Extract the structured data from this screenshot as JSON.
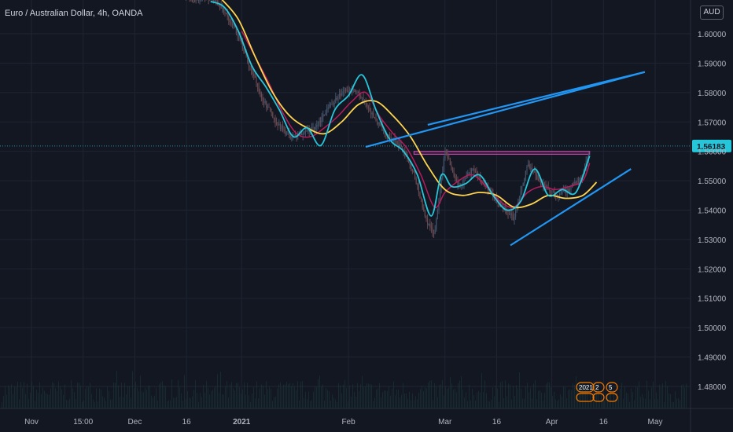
{
  "header": {
    "title": "Euro / Australian Dollar, 4h, OANDA",
    "currency": "AUD"
  },
  "colors": {
    "background": "#131722",
    "grid": "#1f2433",
    "candle_up": "#42546b",
    "candle_down": "#6a4a52",
    "ma_fast": "#26c6da",
    "ma_mid": "#b71c5e",
    "ma_slow": "#ffd54f",
    "trendline": "#2196f3",
    "zone_fill": "#8e2c7a",
    "zone_border": "#c74fb1",
    "price_tag": "#26c6da",
    "volume": "#1c3b3b",
    "event_badge": "#f57c00"
  },
  "chart_data": {
    "type": "line",
    "symbol": "EURAUD",
    "timeframe": "4h",
    "source": "OANDA",
    "x_axis": {
      "ticks": [
        "Nov",
        "15:00",
        "Dec",
        "16",
        "2021",
        "Feb",
        "Mar",
        "16",
        "Apr",
        "16",
        "May"
      ],
      "bold_ticks": [
        "2021"
      ]
    },
    "y_axis": {
      "ylim": [
        1.4725,
        1.6115
      ],
      "ticks": [
        "1.60000",
        "1.59000",
        "1.58000",
        "1.57000",
        "1.56000",
        "1.55000",
        "1.54000",
        "1.53000",
        "1.52000",
        "1.51000",
        "1.50000",
        "1.49000",
        "1.48000"
      ],
      "scale": "linear",
      "side": "right"
    },
    "grid": true,
    "last_price": 1.56183,
    "last_price_label": "1.56183",
    "price_series": {
      "x": [
        "2020-12-14",
        "2020-12-18",
        "2020-12-22",
        "2020-12-26",
        "2020-12-30",
        "2021-01-03",
        "2021-01-07",
        "2021-01-11",
        "2021-01-15",
        "2021-01-19",
        "2021-01-23",
        "2021-01-27",
        "2021-01-31",
        "2021-02-04",
        "2021-02-08",
        "2021-02-12",
        "2021-02-16",
        "2021-02-20",
        "2021-02-24",
        "2021-02-26",
        "2021-03-01",
        "2021-03-05",
        "2021-03-09",
        "2021-03-13",
        "2021-03-17",
        "2021-03-21",
        "2021-03-25",
        "2021-03-29",
        "2021-04-02",
        "2021-04-06",
        "2021-04-10",
        "2021-04-12"
      ],
      "y": [
        1.615,
        1.611,
        1.613,
        1.609,
        1.602,
        1.59,
        1.578,
        1.57,
        1.565,
        1.566,
        1.569,
        1.576,
        1.581,
        1.58,
        1.572,
        1.566,
        1.562,
        1.552,
        1.535,
        1.532,
        1.56,
        1.548,
        1.554,
        1.548,
        1.542,
        1.537,
        1.556,
        1.549,
        1.545,
        1.547,
        1.552,
        1.561
      ]
    },
    "series": [
      {
        "role": "fast_ma",
        "color": "#26c6da",
        "x": [
          "2020-12-23",
          "2020-12-27",
          "2020-12-31",
          "2021-01-04",
          "2021-01-08",
          "2021-01-12",
          "2021-01-16",
          "2021-01-20",
          "2021-01-24",
          "2021-01-28",
          "2021-02-01",
          "2021-02-05",
          "2021-02-09",
          "2021-02-13",
          "2021-02-17",
          "2021-02-21",
          "2021-02-25",
          "2021-02-28",
          "2021-03-03",
          "2021-03-07",
          "2021-03-11",
          "2021-03-15",
          "2021-03-19",
          "2021-03-23",
          "2021-03-27",
          "2021-03-31",
          "2021-04-04",
          "2021-04-08",
          "2021-04-12"
        ],
        "y": [
          1.611,
          1.609,
          1.601,
          1.589,
          1.582,
          1.574,
          1.565,
          1.568,
          1.562,
          1.574,
          1.579,
          1.586,
          1.574,
          1.564,
          1.56,
          1.552,
          1.538,
          1.552,
          1.548,
          1.549,
          1.552,
          1.545,
          1.54,
          1.543,
          1.554,
          1.545,
          1.547,
          1.546,
          1.5585
        ]
      },
      {
        "role": "mid_ma",
        "color": "#b71c5e",
        "x": [
          "2021-01-01",
          "2021-01-05",
          "2021-01-09",
          "2021-01-13",
          "2021-01-17",
          "2021-01-21",
          "2021-01-25",
          "2021-01-29",
          "2021-02-02",
          "2021-02-06",
          "2021-02-10",
          "2021-02-14",
          "2021-02-18",
          "2021-02-22",
          "2021-02-26",
          "2021-03-01",
          "2021-03-05",
          "2021-03-09",
          "2021-03-13",
          "2021-03-17",
          "2021-03-21",
          "2021-03-25",
          "2021-03-29",
          "2021-04-02",
          "2021-04-06",
          "2021-04-10",
          "2021-04-12"
        ],
        "y": [
          1.601,
          1.592,
          1.583,
          1.573,
          1.566,
          1.565,
          1.568,
          1.572,
          1.577,
          1.58,
          1.572,
          1.566,
          1.561,
          1.552,
          1.541,
          1.546,
          1.55,
          1.552,
          1.548,
          1.543,
          1.541,
          1.546,
          1.548,
          1.547,
          1.548,
          1.55,
          1.556
        ]
      },
      {
        "role": "slow_ma",
        "color": "#ffd54f",
        "x": [
          "2020-12-26",
          "2020-12-31",
          "2021-01-05",
          "2021-01-10",
          "2021-01-15",
          "2021-01-20",
          "2021-01-25",
          "2021-01-30",
          "2021-02-04",
          "2021-02-09",
          "2021-02-14",
          "2021-02-19",
          "2021-02-24",
          "2021-03-01",
          "2021-03-06",
          "2021-03-11",
          "2021-03-16",
          "2021-03-21",
          "2021-03-26",
          "2021-03-31",
          "2021-04-05",
          "2021-04-10",
          "2021-04-14"
        ],
        "y": [
          1.612,
          1.605,
          1.592,
          1.58,
          1.572,
          1.568,
          1.566,
          1.57,
          1.576,
          1.577,
          1.572,
          1.565,
          1.555,
          1.547,
          1.545,
          1.546,
          1.545,
          1.541,
          1.542,
          1.545,
          1.544,
          1.545,
          1.5495
        ]
      }
    ],
    "annotations": [
      {
        "type": "trendline",
        "color": "#2196f3",
        "from": {
          "x": "2021-02-06",
          "y": 1.5615
        },
        "to": {
          "x": "2021-04-28",
          "y": 1.587
        }
      },
      {
        "type": "trendline",
        "color": "#2196f3",
        "from": {
          "x": "2021-02-24",
          "y": 1.569
        },
        "to": {
          "x": "2021-04-28",
          "y": 1.587
        }
      },
      {
        "type": "trendline",
        "color": "#2196f3",
        "from": {
          "x": "2021-03-20",
          "y": 1.528
        },
        "to": {
          "x": "2021-04-24",
          "y": 1.554
        }
      },
      {
        "type": "zone",
        "color": "#8e2c7a",
        "from": {
          "x": "2021-02-20",
          "y": 1.56
        },
        "to": {
          "x": "2021-04-12",
          "y": 1.559
        }
      }
    ],
    "events": {
      "labels": [
        "2021",
        "2",
        "5"
      ]
    }
  }
}
